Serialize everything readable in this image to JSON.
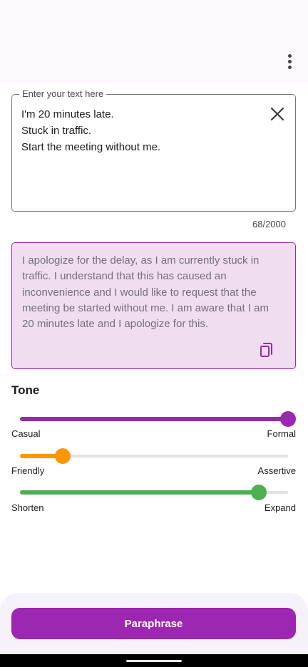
{
  "app_bar": {
    "menu_icon": "more-vert-icon"
  },
  "input": {
    "label": "Enter your text here",
    "value": "I'm 20 minutes late.\nStuck in traffic.\nStart the meeting without me.",
    "clear_icon": "close-icon",
    "char_count": "68/2000"
  },
  "output": {
    "text": "I apologize for the delay, as I am currently stuck in traffic. I understand that this has caused an inconvenience and I would like to request that the meeting be started without me. I am aware that I am 20 minutes late and I apologize for this.",
    "copy_icon": "copy-icon"
  },
  "tone": {
    "heading": "Tone",
    "sliders": [
      {
        "left_label": "Casual",
        "right_label": "Formal",
        "value": 1.0,
        "color": "#9c27b0"
      },
      {
        "left_label": "Friendly",
        "right_label": "Assertive",
        "value": 0.16,
        "color": "#ff9800"
      },
      {
        "left_label": "Shorten",
        "right_label": "Expand",
        "value": 0.89,
        "color": "#4caf50"
      }
    ]
  },
  "action": {
    "label": "Paraphrase"
  },
  "colors": {
    "accent": "#9c27b0",
    "output_background": "#f0ddf0",
    "app_bar_background": "#fdf7fe"
  }
}
